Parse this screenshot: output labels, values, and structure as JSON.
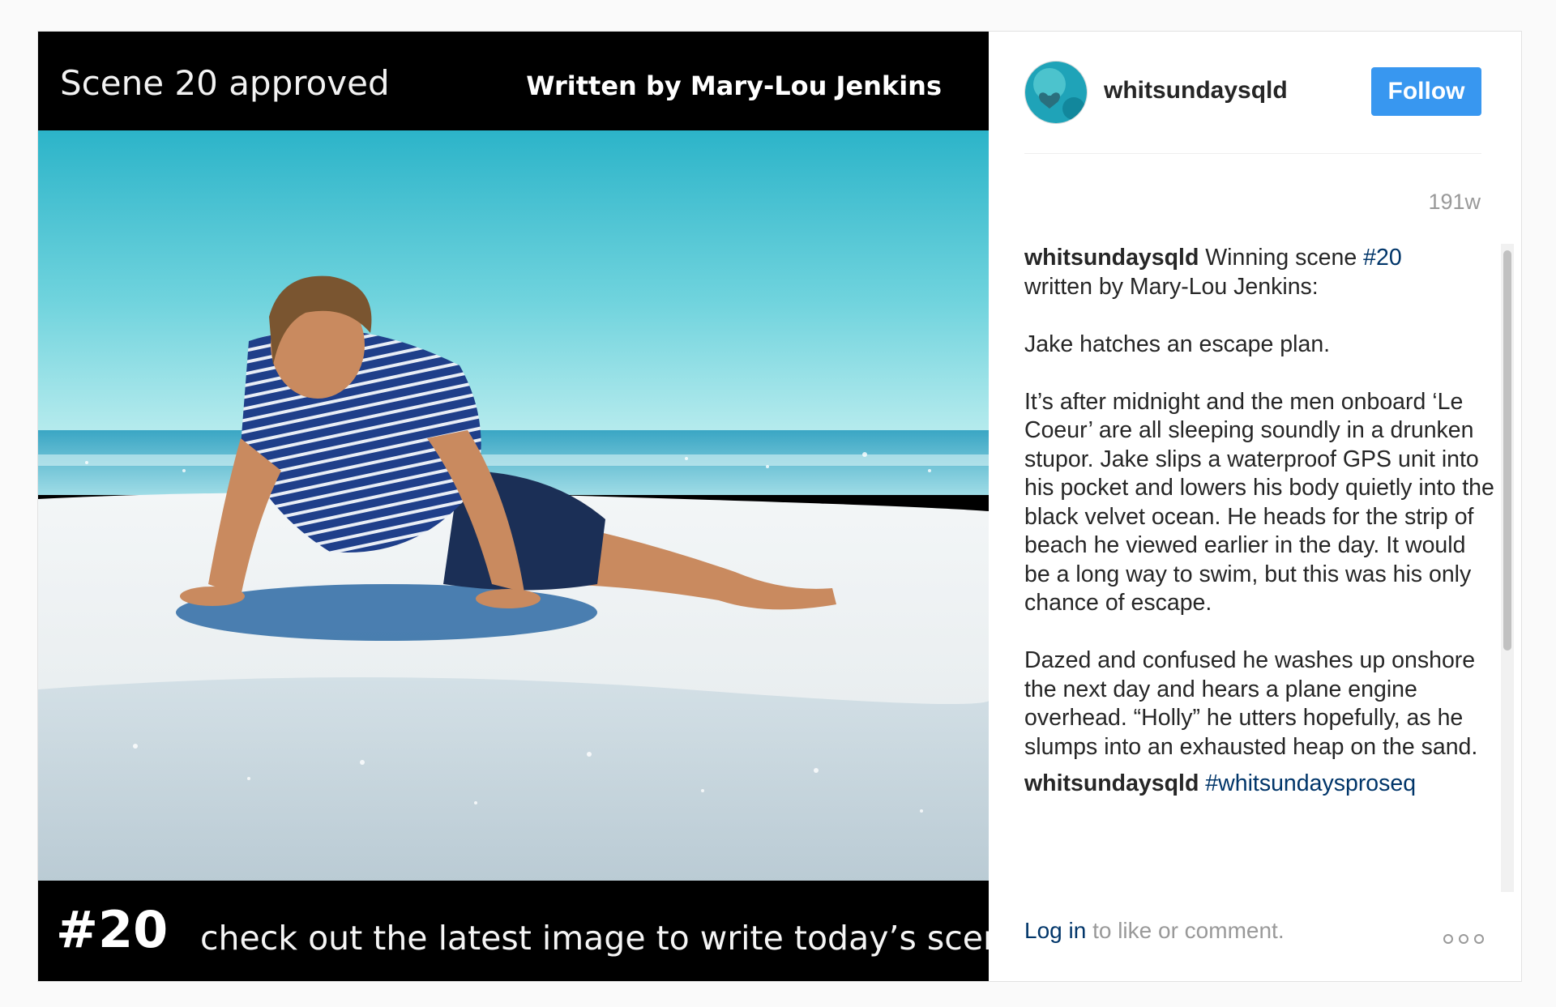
{
  "media": {
    "top_left": "Scene 20 approved",
    "top_right": "Written by Mary-Lou Jenkins",
    "bottom_number": "#20",
    "bottom_cta": "check out the latest image to write today’s scene",
    "photo_icon": "beach-photo"
  },
  "header": {
    "username": "whitsundaysqld",
    "follow_label": "Follow",
    "avatar_icon": "heart-reef-avatar-icon"
  },
  "timestamp": "191w",
  "caption": {
    "username": "whitsundaysqld",
    "intro": "Winning scene",
    "hashtag": "#20",
    "intro_tail": "written by Mary-Lou Jenkins:",
    "paragraph_1": "Jake hatches an escape plan.",
    "paragraph_2": "It’s after midnight and the men onboard ‘Le Coeur’ are all sleeping soundly in a drunken stupor. Jake slips a waterproof GPS unit into his pocket and lowers his body quietly into the black velvet ocean. He heads for the strip of beach he viewed earlier in the day. It would be a long way to swim, but this was his only chance of escape.",
    "paragraph_3": "Dazed and confused he washes up onshore the next day and hears a plane engine overhead. “Holly” he utters hopefully, as he slumps into an exhausted heap on the sand.",
    "next_username": "whitsundaysqld",
    "next_hashtag": "#whitsundaysproseq"
  },
  "footer": {
    "login_link": "Log in",
    "login_text": "to like or comment.",
    "more_icon": "more-options-icon"
  },
  "colors": {
    "accent": "#3897f0",
    "link": "#003569",
    "muted": "#999999"
  }
}
